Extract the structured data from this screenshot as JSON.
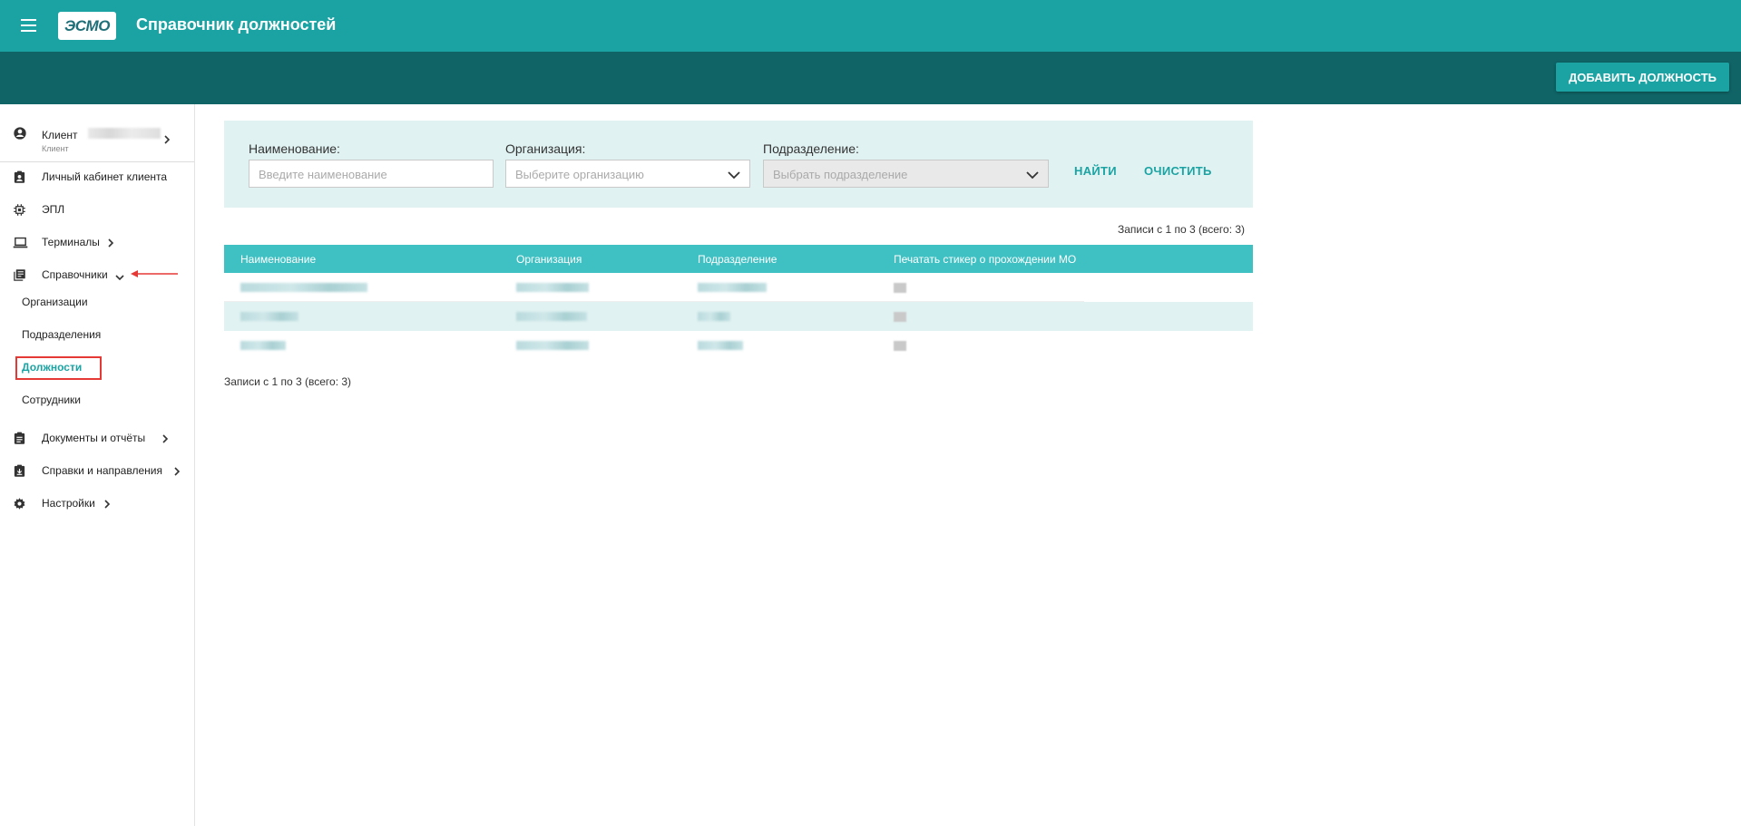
{
  "header": {
    "logo_text": "ЭСМО",
    "title": "Справочник должностей",
    "add_button": "ДОБАВИТЬ ДОЛЖНОСТЬ",
    "bg_color": "#1ba3a3",
    "subbar_color": "#106466"
  },
  "sidebar": {
    "client": {
      "label": "Клиент",
      "sublabel": "Клиент"
    },
    "items": [
      {
        "label": "Личный кабинет клиента",
        "icon": "account-box-icon"
      },
      {
        "label": "ЭПЛ",
        "icon": "chip-icon"
      },
      {
        "label": "Терминалы",
        "icon": "laptop-icon",
        "expandable": true
      },
      {
        "label": "Справочники",
        "icon": "library-books-icon",
        "expanded": true
      },
      {
        "label": "Документы и отчёты",
        "icon": "clipboard-icon",
        "expandable": true
      },
      {
        "label": "Справки и направления",
        "icon": "clipboard-download-icon",
        "expandable": true
      },
      {
        "label": "Настройки",
        "icon": "gear-icon",
        "expandable": true
      }
    ],
    "sub_items": [
      {
        "label": "Организации"
      },
      {
        "label": "Подразделения"
      },
      {
        "label": "Должности",
        "active": true
      },
      {
        "label": "Сотрудники"
      }
    ]
  },
  "filters": {
    "name_label": "Наименование:",
    "name_placeholder": "Введите наименование",
    "org_label": "Организация:",
    "org_placeholder": "Выберите организацию",
    "dept_label": "Подразделение:",
    "dept_placeholder": "Выбрать подразделение",
    "find_button": "НАЙТИ",
    "clear_button": "ОЧИСТИТЬ"
  },
  "records_text": "Записи с 1 по 3 (всего: 3)",
  "table": {
    "columns": [
      "Наименование",
      "Организация",
      "Подразделение",
      "Печатать стикер о прохождении МО"
    ],
    "row_count": 3
  }
}
